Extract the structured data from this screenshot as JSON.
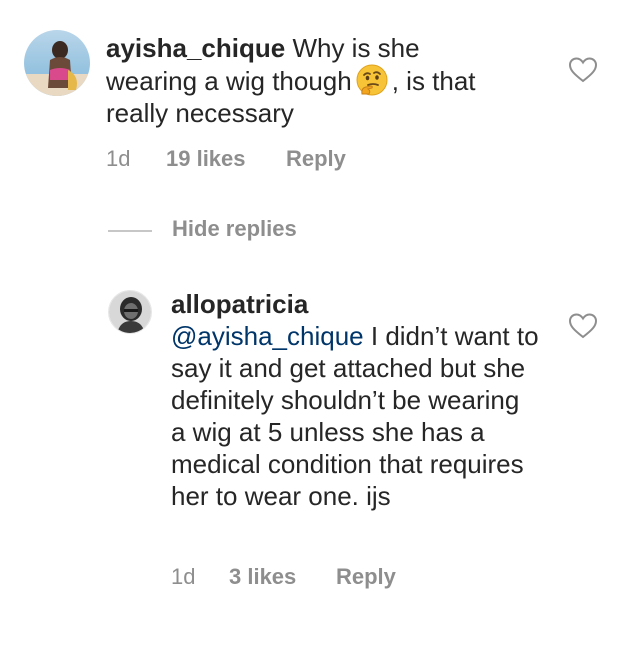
{
  "comments": [
    {
      "username": "ayisha_chique",
      "text_before_emoji": "Why is she wearing a wig though",
      "emoji": "thinking-face",
      "text_after_emoji": ", is that really necessary",
      "time": "1d",
      "likes": "19 likes",
      "reply_label": "Reply"
    },
    {
      "username": "allopatricia",
      "mention": "@ayisha_chique",
      "text": "I didn’t want to say it and get attached but she definitely shouldn’t be wearing a wig at 5 unless she has a medical condition that requires her to wear one. ijs",
      "time": "1d",
      "likes": "3 likes",
      "reply_label": "Reply"
    }
  ],
  "replies_toggle": {
    "label": "Hide replies"
  },
  "icons": {
    "like": "heart-outline-icon"
  },
  "colors": {
    "text": "#262626",
    "meta": "#8e8e8e",
    "mention": "#003569"
  }
}
